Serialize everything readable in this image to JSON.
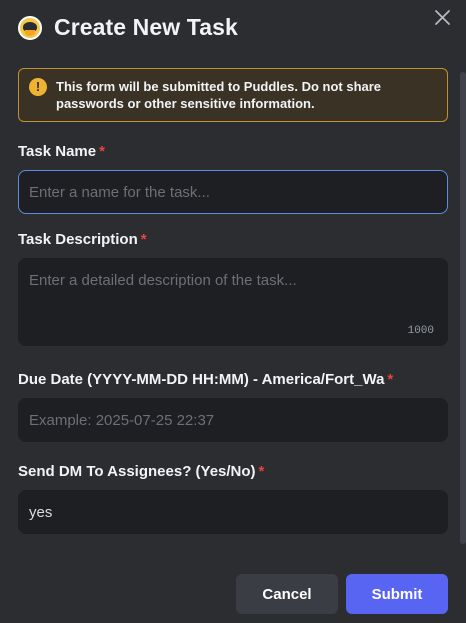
{
  "modal": {
    "title": "Create New Task",
    "close_icon": "close-icon",
    "app_icon": "duck-avatar"
  },
  "warning": {
    "text": "This form will be submitted to Puddles. Do not share passwords or other sensitive information.",
    "icon": "!"
  },
  "fields": {
    "task_name": {
      "label": "Task Name",
      "required_mark": "*",
      "placeholder": "Enter a name for the task...",
      "value": ""
    },
    "task_description": {
      "label": "Task Description",
      "required_mark": "*",
      "placeholder": "Enter a detailed description of the task...",
      "value": "",
      "remaining_chars": "1000"
    },
    "due_date": {
      "label": "Due Date (YYYY-MM-DD HH:MM) - America/Fort_Wa",
      "required_mark": "*",
      "placeholder": "Example: 2025-07-25 22:37",
      "value": ""
    },
    "send_dm": {
      "label": "Send DM To Assignees? (Yes/No)",
      "required_mark": "*",
      "placeholder": "",
      "value": "yes"
    }
  },
  "buttons": {
    "cancel": "Cancel",
    "submit": "Submit"
  },
  "colors": {
    "accent": "#5865f2",
    "required": "#f23f43",
    "warning_border": "#c28f2c",
    "focus_border": "#5b8ce8"
  }
}
